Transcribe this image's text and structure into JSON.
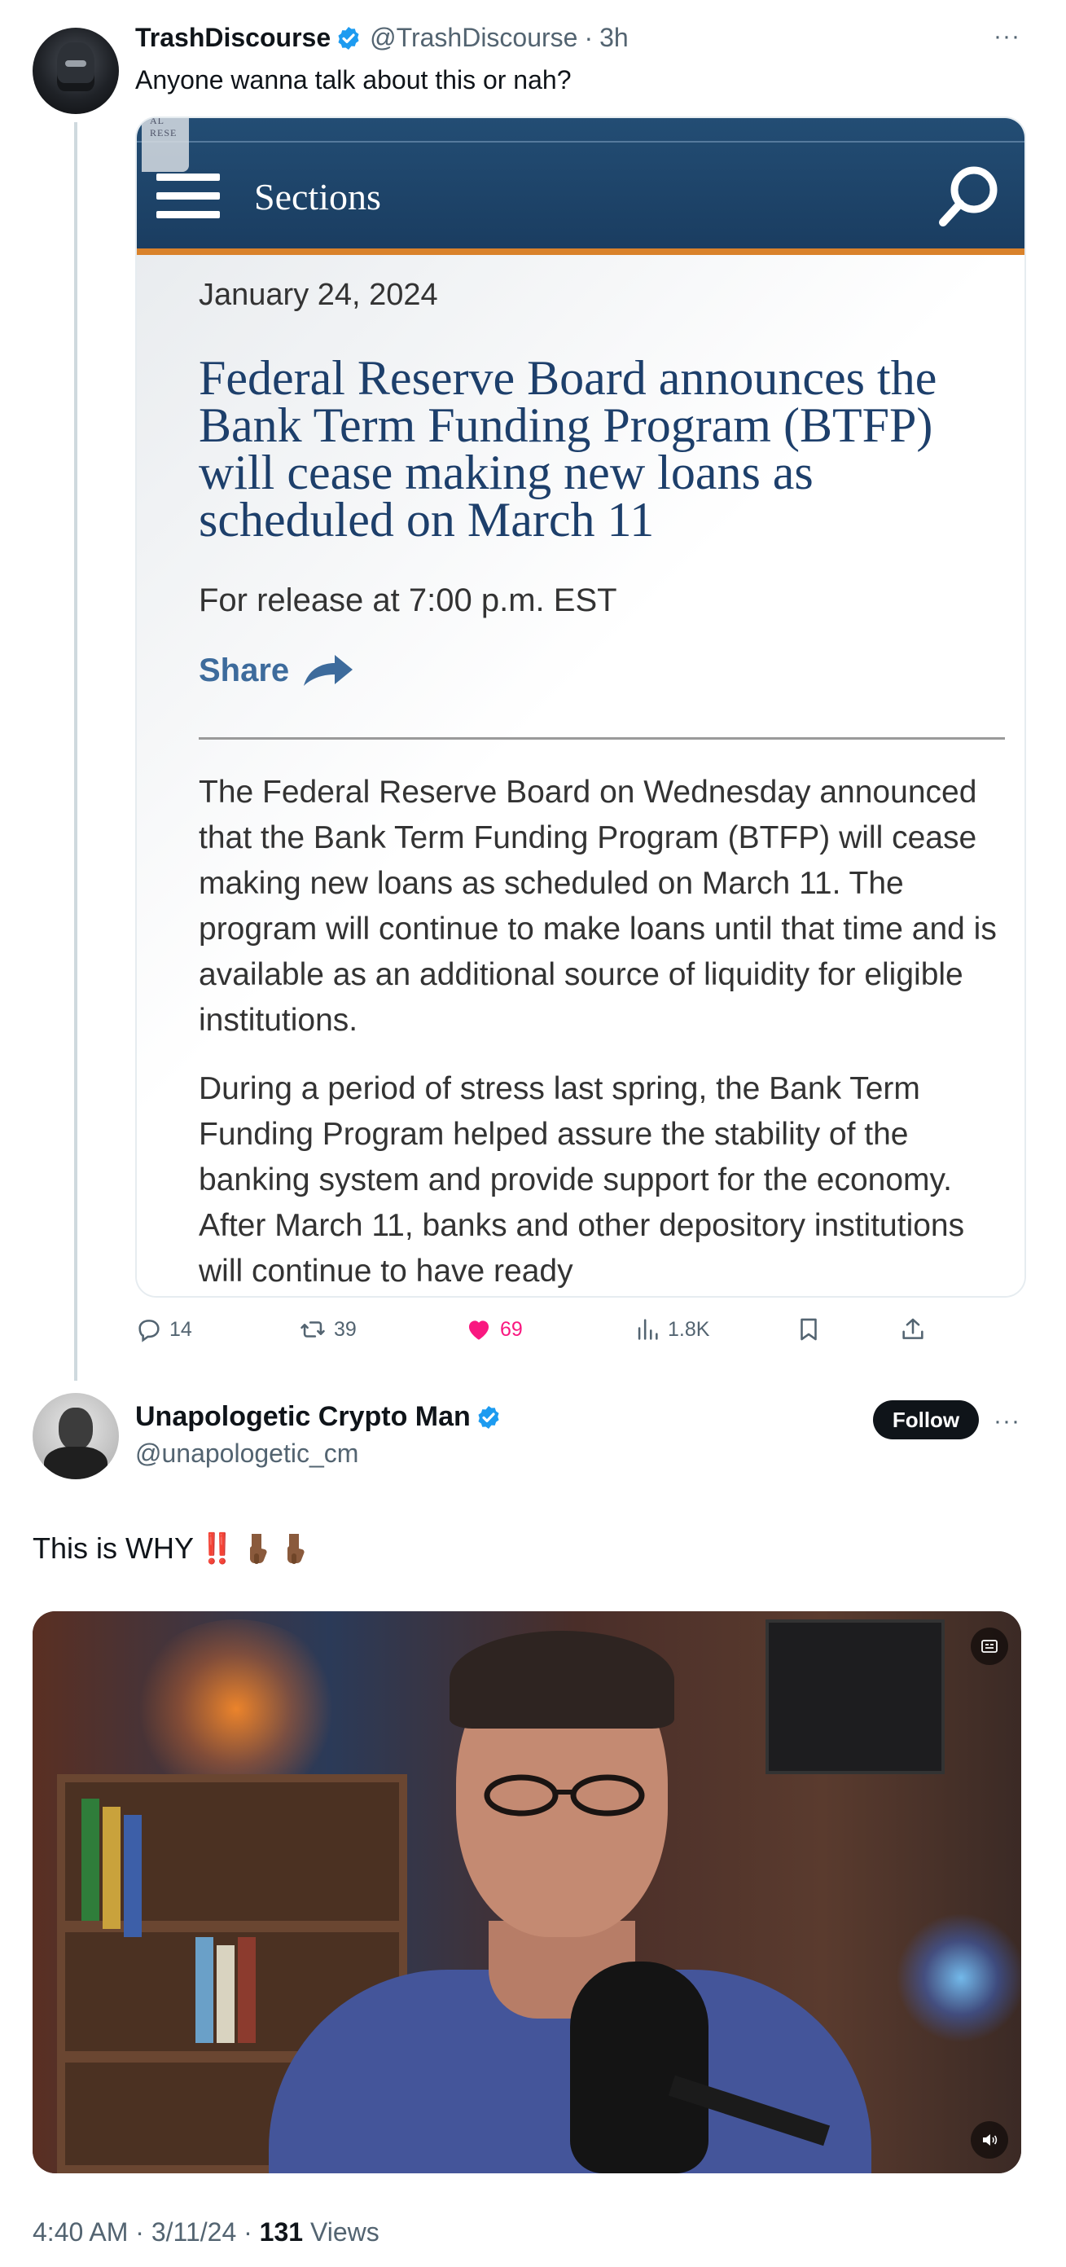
{
  "tweet1": {
    "display_name": "TrashDiscourse",
    "handle": "@TrashDiscourse",
    "time": "3h",
    "text": "Anyone wanna talk about this or nah?",
    "more": "···",
    "article": {
      "seal_text": "AL RESE",
      "sections_label": "Sections",
      "date": "January 24, 2024",
      "title": "Federal Reserve Board announces the Bank Term Funding Program (BTFP) will cease making new loans as scheduled on March 11",
      "release": "For release at 7:00 p.m. EST",
      "share_label": "Share",
      "paragraph1": "The Federal Reserve Board on Wednesday announced that the Bank Term Funding Program (BTFP) will cease making new loans as scheduled on March 11. The program will continue to make loans until that time and is available as an additional source of liquidity for eligible institutions.",
      "paragraph2": "During a period of stress last spring, the Bank Term Funding Program helped assure the stability of the banking system and provide support for the economy. After March 11, banks and other depository institutions will continue to have ready"
    },
    "actions": {
      "replies": "14",
      "reposts": "39",
      "likes": "69",
      "views": "1.8K"
    }
  },
  "tweet2": {
    "display_name": "Unapologetic Crypto Man",
    "handle": "@unapologetic_cm",
    "follow_label": "Follow",
    "more": "···",
    "text": "This is WHY",
    "text_bang": "‼️"
  },
  "footer": {
    "time": "4:40 AM",
    "sep1": " · ",
    "date": "3/11/24",
    "sep2": " · ",
    "views_count": "131",
    "views_label": " Views"
  },
  "colors": {
    "verified": "#1d9bf0",
    "like": "#f91880",
    "fed_navy": "#1d3f6b",
    "fed_orange": "#d9822b",
    "secondary_text": "#536471"
  },
  "icons": {
    "reply": "reply-icon",
    "repost": "repost-icon",
    "like": "heart-icon",
    "views": "views-icon",
    "bookmark": "bookmark-icon",
    "share": "share-icon"
  }
}
